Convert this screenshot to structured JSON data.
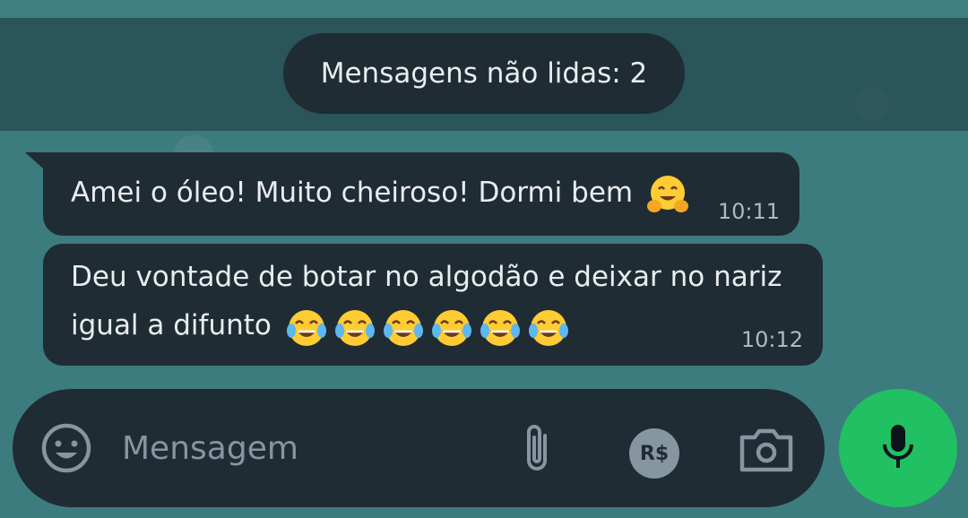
{
  "unread_banner": {
    "label": "Mensagens não lidas: 2"
  },
  "messages": [
    {
      "text": "Amei o óleo! Muito cheiroso! Dormi bem",
      "emojis": [
        "hugging-face"
      ],
      "time": "10:11"
    },
    {
      "line1": "Deu vontade de botar no algodão e deixar no nariz",
      "line2": "igual a difunto",
      "emojis": [
        "tears-of-joy",
        "tears-of-joy",
        "tears-of-joy",
        "tears-of-joy",
        "tears-of-joy",
        "tears-of-joy"
      ],
      "time": "10:12"
    }
  ],
  "composer": {
    "placeholder": "Mensagem",
    "pay_label": "R$",
    "icons": [
      "smiley-icon",
      "paperclip-icon",
      "payment-icon",
      "camera-icon",
      "microphone-icon"
    ]
  },
  "colors": {
    "wallpaper": "#3d7c7e",
    "bubble": "#202c33",
    "text": "#e9edef",
    "meta": "#aebac1",
    "mic": "#21c063"
  }
}
